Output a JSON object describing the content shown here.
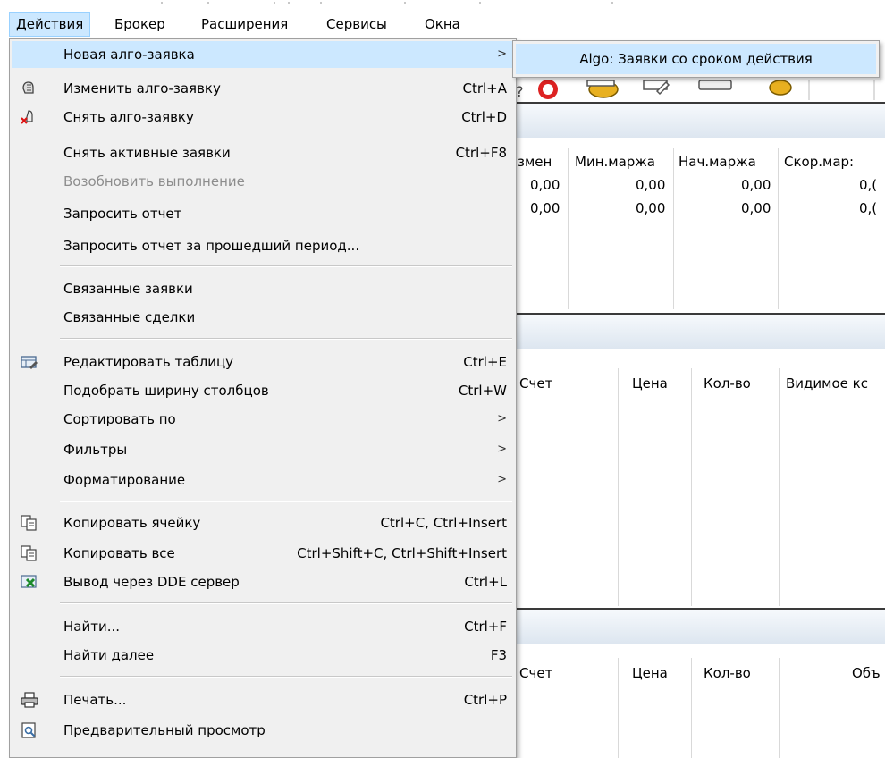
{
  "menubar": {
    "items": [
      {
        "label": "Действия"
      },
      {
        "label": "Брокер"
      },
      {
        "label": "Расширения"
      },
      {
        "label": "Сервисы"
      },
      {
        "label": "Окна"
      }
    ]
  },
  "menu": {
    "items": [
      {
        "label": "Новая алго-заявка",
        "shortcut": "",
        "arrow": ">"
      },
      {
        "label": "Изменить алго-заявку",
        "shortcut": "Ctrl+A",
        "icon": "edit-algo-order-icon"
      },
      {
        "label": "Снять алго-заявку",
        "shortcut": "Ctrl+D",
        "icon": "cancel-algo-order-icon"
      },
      {
        "label": "Снять активные заявки",
        "shortcut": "Ctrl+F8"
      },
      {
        "label": "Возобновить выполнение",
        "shortcut": "",
        "disabled": true
      },
      {
        "label": "Запросить отчет",
        "shortcut": ""
      },
      {
        "label": "Запросить отчет за прошедший период...",
        "shortcut": ""
      },
      {
        "label": "Связанные заявки",
        "shortcut": ""
      },
      {
        "label": "Связанные сделки",
        "shortcut": ""
      },
      {
        "label": "Редактировать таблицу",
        "shortcut": "Ctrl+E",
        "icon": "edit-table-icon"
      },
      {
        "label": "Подобрать ширину столбцов",
        "shortcut": "Ctrl+W"
      },
      {
        "label": "Сортировать по",
        "arrow": ">"
      },
      {
        "label": "Фильтры",
        "arrow": ">"
      },
      {
        "label": "Форматирование",
        "arrow": ">"
      },
      {
        "label": "Копировать ячейку",
        "shortcut": "Ctrl+C, Ctrl+Insert",
        "icon": "copy-icon"
      },
      {
        "label": "Копировать все",
        "shortcut": "Ctrl+Shift+C, Ctrl+Shift+Insert",
        "icon": "copy-icon"
      },
      {
        "label": "Вывод через DDE сервер",
        "shortcut": "Ctrl+L",
        "icon": "excel-export-icon"
      },
      {
        "label": "Найти...",
        "shortcut": "Ctrl+F"
      },
      {
        "label": "Найти далее",
        "shortcut": "F3"
      },
      {
        "label": "Печать...",
        "shortcut": "Ctrl+P",
        "icon": "printer-icon"
      },
      {
        "label": "Предварительный просмотр",
        "shortcut": "",
        "icon": "print-preview-icon"
      }
    ]
  },
  "submenu": {
    "items": [
      {
        "label": "Algo: Заявки со сроком действия"
      }
    ]
  },
  "background": {
    "table1": {
      "headers": [
        "змен",
        "Мин.маржа",
        "Нач.маржа",
        "Скор.мар:"
      ],
      "rows": [
        [
          "0,00",
          "0,00",
          "0,00",
          "0,("
        ],
        [
          "0,00",
          "0,00",
          "0,00",
          "0,("
        ]
      ]
    },
    "table2": {
      "headers": [
        "Счет",
        "Цена",
        "Кол-во",
        "Видимое кс"
      ]
    },
    "table3": {
      "headers": [
        "Счет",
        "Цена",
        "Кол-во",
        "Объ"
      ]
    }
  }
}
